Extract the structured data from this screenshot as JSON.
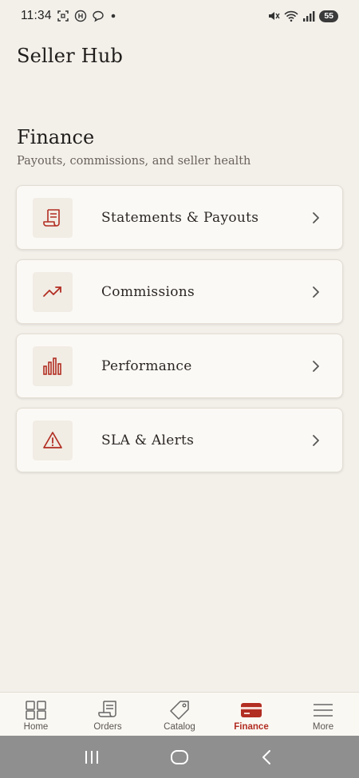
{
  "status_bar": {
    "time": "11:34",
    "battery": "55",
    "left_icons": [
      "screenshot-icon",
      "app-notification-icon",
      "chat-bubble-icon",
      "dot-icon"
    ],
    "right_icons": [
      "mute-icon",
      "wifi-icon",
      "signal-icon",
      "battery-icon"
    ]
  },
  "app": {
    "title": "Seller Hub"
  },
  "section": {
    "title": "Finance",
    "subtitle": "Payouts, commissions, and seller health"
  },
  "cards": [
    {
      "label": "Statements & Payouts",
      "icon": "receipt-icon"
    },
    {
      "label": "Commissions",
      "icon": "trend-up-icon"
    },
    {
      "label": "Performance",
      "icon": "bar-chart-icon"
    },
    {
      "label": "SLA & Alerts",
      "icon": "warning-icon"
    }
  ],
  "bottom_nav": [
    {
      "label": "Home",
      "icon": "grid-icon",
      "active": false
    },
    {
      "label": "Orders",
      "icon": "receipt-icon",
      "active": false
    },
    {
      "label": "Catalog",
      "icon": "tag-icon",
      "active": false
    },
    {
      "label": "Finance",
      "icon": "wallet-card-icon",
      "active": true
    },
    {
      "label": "More",
      "icon": "menu-icon",
      "active": false
    }
  ],
  "colors": {
    "accent": "#b22d22",
    "background": "#f3f0ea",
    "card": "#fbf9f5",
    "text": "#2a2623",
    "muted": "#6a625b"
  },
  "system_nav": [
    "recent-apps-icon",
    "home-icon",
    "back-icon"
  ]
}
